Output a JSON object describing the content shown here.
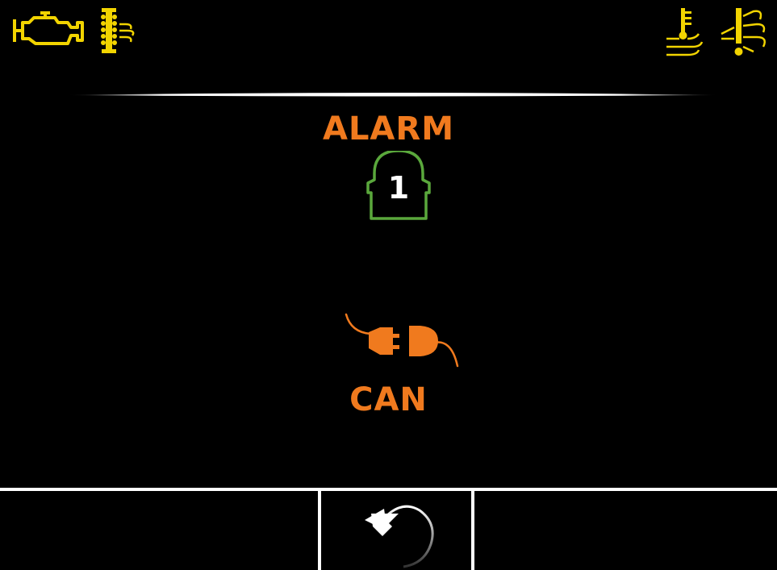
{
  "screen": {
    "alarm_title": "ALARM",
    "alarm_number": "1",
    "alarm_source": "CAN"
  },
  "status_icons": [
    {
      "name": "check-engine-icon",
      "color": "#f2d400"
    },
    {
      "name": "glow-plug-exhaust-icon",
      "color": "#f2d400"
    },
    {
      "name": "coolant-temperature-icon",
      "color": "#f2d400"
    },
    {
      "name": "oil-pressure-warning-icon",
      "color": "#f2d400"
    }
  ],
  "softkeys": {
    "left": "",
    "center": "back-icon",
    "right": ""
  },
  "colors": {
    "background": "#000000",
    "accent_orange": "#f07a1e",
    "badge_green": "#5aa83c",
    "warning_yellow": "#f2d400",
    "divider": "#ffffff"
  }
}
